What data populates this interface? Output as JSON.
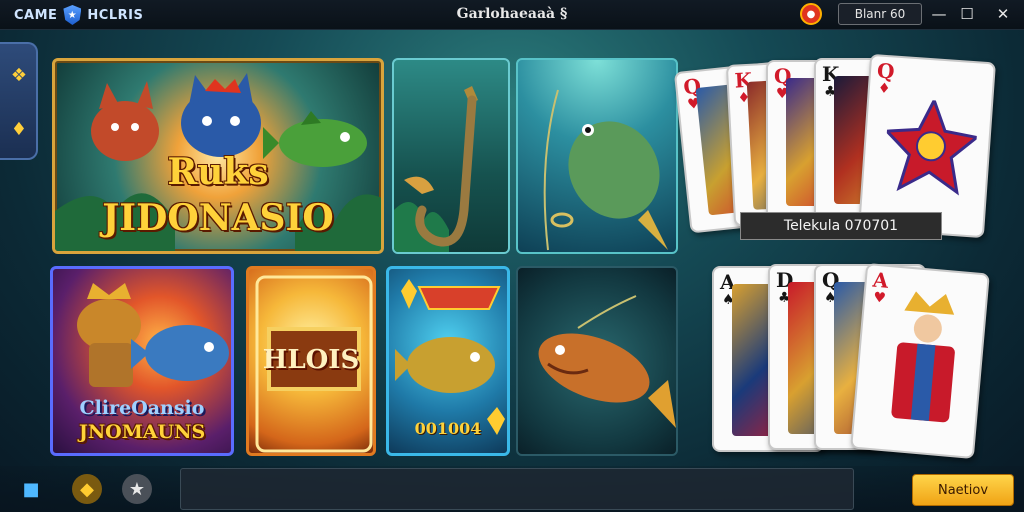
{
  "titlebar": {
    "brand": "CAME",
    "brand_suffix": "HCLRIS",
    "window_title": "Garlohaeaaà §",
    "badge_text": "Blanr 60",
    "minimize_glyph": "—",
    "maximize_glyph": "☐",
    "close_glyph": "✕",
    "icons": [
      "shield-icon",
      "record-icon"
    ]
  },
  "side_rail": {
    "icons": [
      "rune-icon",
      "puzzle-icon"
    ]
  },
  "tiles": {
    "featured": {
      "title_line1": "Ruks",
      "title_line2": "JIDONASIO"
    },
    "hook": {
      "name": "hook-tile"
    },
    "fish_line": {
      "name": "fish-on-line-tile"
    },
    "combo": {
      "title_line1": "ClireOansio",
      "title_line2": "JNOMAUNS"
    },
    "hlois": {
      "title": "HLOIS"
    },
    "fish_value": {
      "value": "001004"
    },
    "catch": {
      "name": "catch-tile"
    }
  },
  "cards": {
    "top_row": [
      {
        "rank": "Q",
        "suit": "♥",
        "color": "red"
      },
      {
        "rank": "K",
        "suit": "♦",
        "color": "red"
      },
      {
        "rank": "Q",
        "suit": "♥",
        "color": "red"
      },
      {
        "rank": "K",
        "suit": "♣",
        "color": "black"
      },
      {
        "rank": "Q",
        "suit": "♦",
        "color": "red"
      }
    ],
    "bottom_row": [
      {
        "rank": "A",
        "suit": "♠",
        "color": "black"
      },
      {
        "rank": "D",
        "suit": "♣",
        "color": "black"
      },
      {
        "rank": "Q",
        "suit": "♠",
        "color": "black"
      },
      {
        "rank": "A",
        "suit": "♥",
        "color": "red"
      }
    ],
    "info_label": "Telekula 070701"
  },
  "bottom_bar": {
    "icons": [
      "cube-icon",
      "coin-icon",
      "star-icon"
    ],
    "action_label": "Naetiov"
  },
  "colors": {
    "accent_gold": "#f0a315",
    "frame_gold": "#d9a43c",
    "card_red": "#d11a2a"
  }
}
